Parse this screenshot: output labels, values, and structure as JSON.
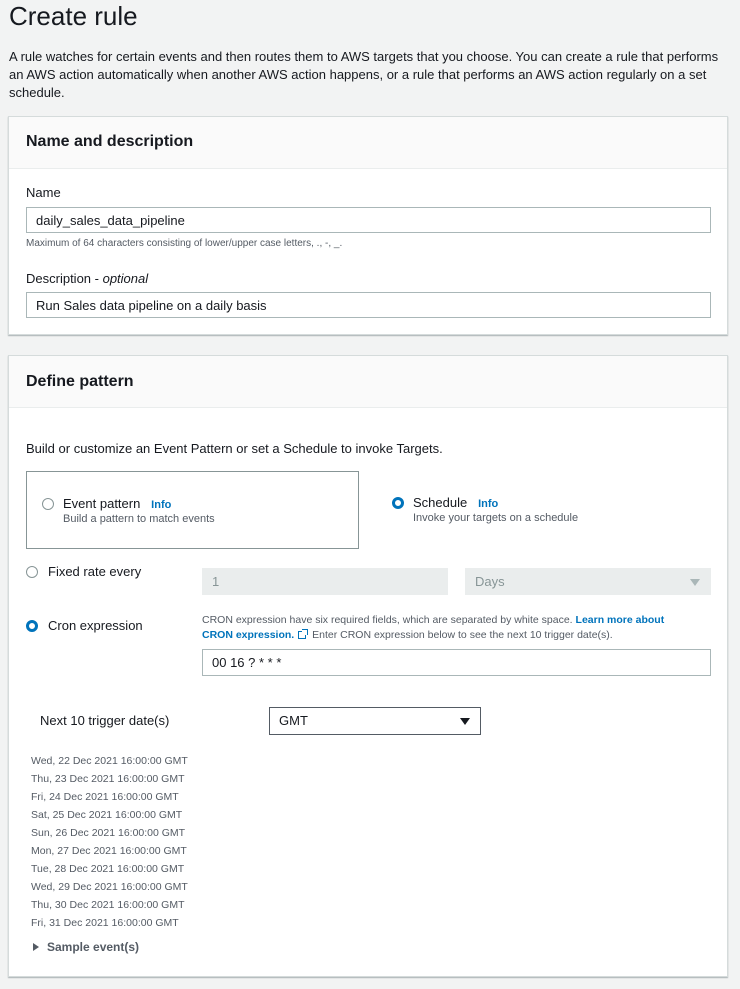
{
  "page": {
    "title": "Create rule",
    "description": "A rule watches for certain events and then routes them to AWS targets that you choose. You can create a rule that performs an AWS action automatically when another AWS action happens, or a rule that performs an AWS action regularly on a set schedule."
  },
  "name_panel": {
    "title": "Name and description",
    "name_label": "Name",
    "name_value": "daily_sales_data_pipeline",
    "name_hint": "Maximum of 64 characters consisting of lower/upper case letters, ., -, _.",
    "description_label": "Description",
    "description_optional": "optional",
    "description_value": "Run Sales data pipeline on a daily basis"
  },
  "pattern_panel": {
    "title": "Define pattern",
    "intro": "Build or customize an Event Pattern or set a Schedule to invoke Targets.",
    "event_pattern": {
      "label": "Event pattern",
      "info": "Info",
      "description": "Build a pattern to match events",
      "selected": false
    },
    "schedule": {
      "label": "Schedule",
      "info": "Info",
      "description": "Invoke your targets on a schedule",
      "selected": true
    },
    "fixed_rate": {
      "label": "Fixed rate every",
      "value": "1",
      "unit": "Days",
      "selected": false
    },
    "cron": {
      "label": "Cron expression",
      "selected": true,
      "help_prefix": "CRON expression have six required fields, which are separated by white space.",
      "help_link": "Learn more about CRON expression.",
      "help_suffix": "Enter CRON expression below to see the next 10 trigger date(s).",
      "value": "00 16 ? * * *"
    },
    "trigger_dates": {
      "label": "Next 10 trigger date(s)",
      "timezone": "GMT",
      "dates": [
        "Wed, 22 Dec 2021 16:00:00 GMT",
        "Thu, 23 Dec 2021 16:00:00 GMT",
        "Fri, 24 Dec 2021 16:00:00 GMT",
        "Sat, 25 Dec 2021 16:00:00 GMT",
        "Sun, 26 Dec 2021 16:00:00 GMT",
        "Mon, 27 Dec 2021 16:00:00 GMT",
        "Tue, 28 Dec 2021 16:00:00 GMT",
        "Wed, 29 Dec 2021 16:00:00 GMT",
        "Thu, 30 Dec 2021 16:00:00 GMT",
        "Fri, 31 Dec 2021 16:00:00 GMT"
      ]
    },
    "sample_events_label": "Sample event(s)"
  },
  "colors": {
    "link": "#0073bb",
    "text": "#16191f",
    "muted": "#545b64",
    "background": "#f2f3f3"
  }
}
